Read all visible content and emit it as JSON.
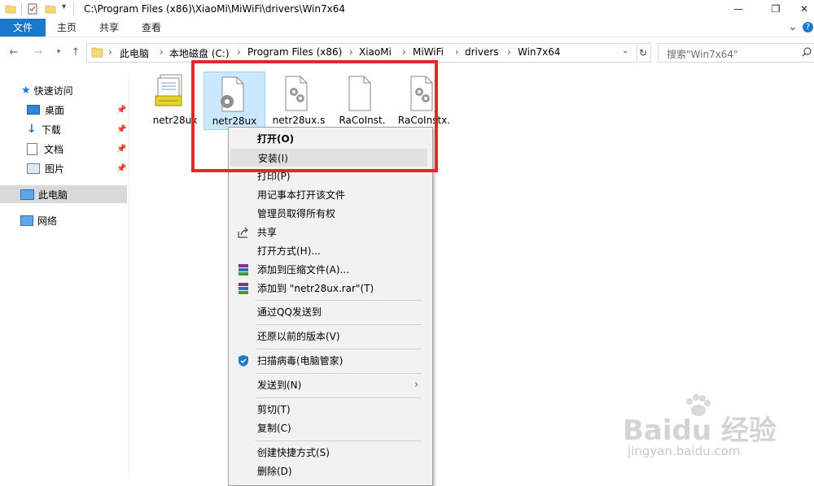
{
  "window": {
    "title": "C:\\Program Files (x86)\\XiaoMi\\MiWiFi\\drivers\\Win7x64",
    "minimize_glyph": "—",
    "maximize_glyph": "❐",
    "close_glyph": "✕",
    "expand_glyph": "⌄",
    "help_glyph": "?"
  },
  "ribbon": {
    "tabs": [
      "文件",
      "主页",
      "共享",
      "查看"
    ]
  },
  "address": {
    "crumbs": [
      "此电脑",
      "本地磁盘 (C:)",
      "Program Files (x86)",
      "XiaoMi",
      "MiWiFi",
      "drivers",
      "Win7x64"
    ],
    "search_placeholder": "搜索\"Win7x64\""
  },
  "nav_pane": {
    "quick_access": "快速访问",
    "items": [
      "桌面",
      "下载",
      "文档",
      "图片"
    ],
    "this_pc": "此电脑",
    "network": "网络"
  },
  "files": [
    {
      "name": "netr28ux",
      "icon": "catalog-file-icon"
    },
    {
      "name": "netr28ux",
      "icon": "setup-info-file-icon"
    },
    {
      "name": "netr28ux.s",
      "icon": "system-file-icon"
    },
    {
      "name": "RaCoInst.",
      "icon": "blank-file-icon"
    },
    {
      "name": "RaCoInstx.",
      "icon": "system-file-icon"
    }
  ],
  "context_menu": {
    "open": "打开(O)",
    "install": "安装(I)",
    "print": "打印(P)",
    "notepad": "用记事本打开该文件",
    "take_ownership": "管理员取得所有权",
    "share": "共享",
    "open_with": "打开方式(H)...",
    "add_archive": "添加到压缩文件(A)...",
    "add_rar": "添加到 \"netr28ux.rar\"(T)",
    "send_qq": "通过QQ发送到",
    "restore": "还原以前的版本(V)",
    "scan": "扫描病毒(电脑管家)",
    "send_to": "发送到(N)",
    "cut": "剪切(T)",
    "copy": "复制(C)",
    "shortcut": "创建快捷方式(S)",
    "delete": "删除(D)"
  },
  "watermark": {
    "brand": "Baidu 经验",
    "url": "jingyan.baidu.com"
  },
  "colors": {
    "accent": "#1979ca",
    "highlight": "#e5262b",
    "selection": "#cce8ff"
  }
}
